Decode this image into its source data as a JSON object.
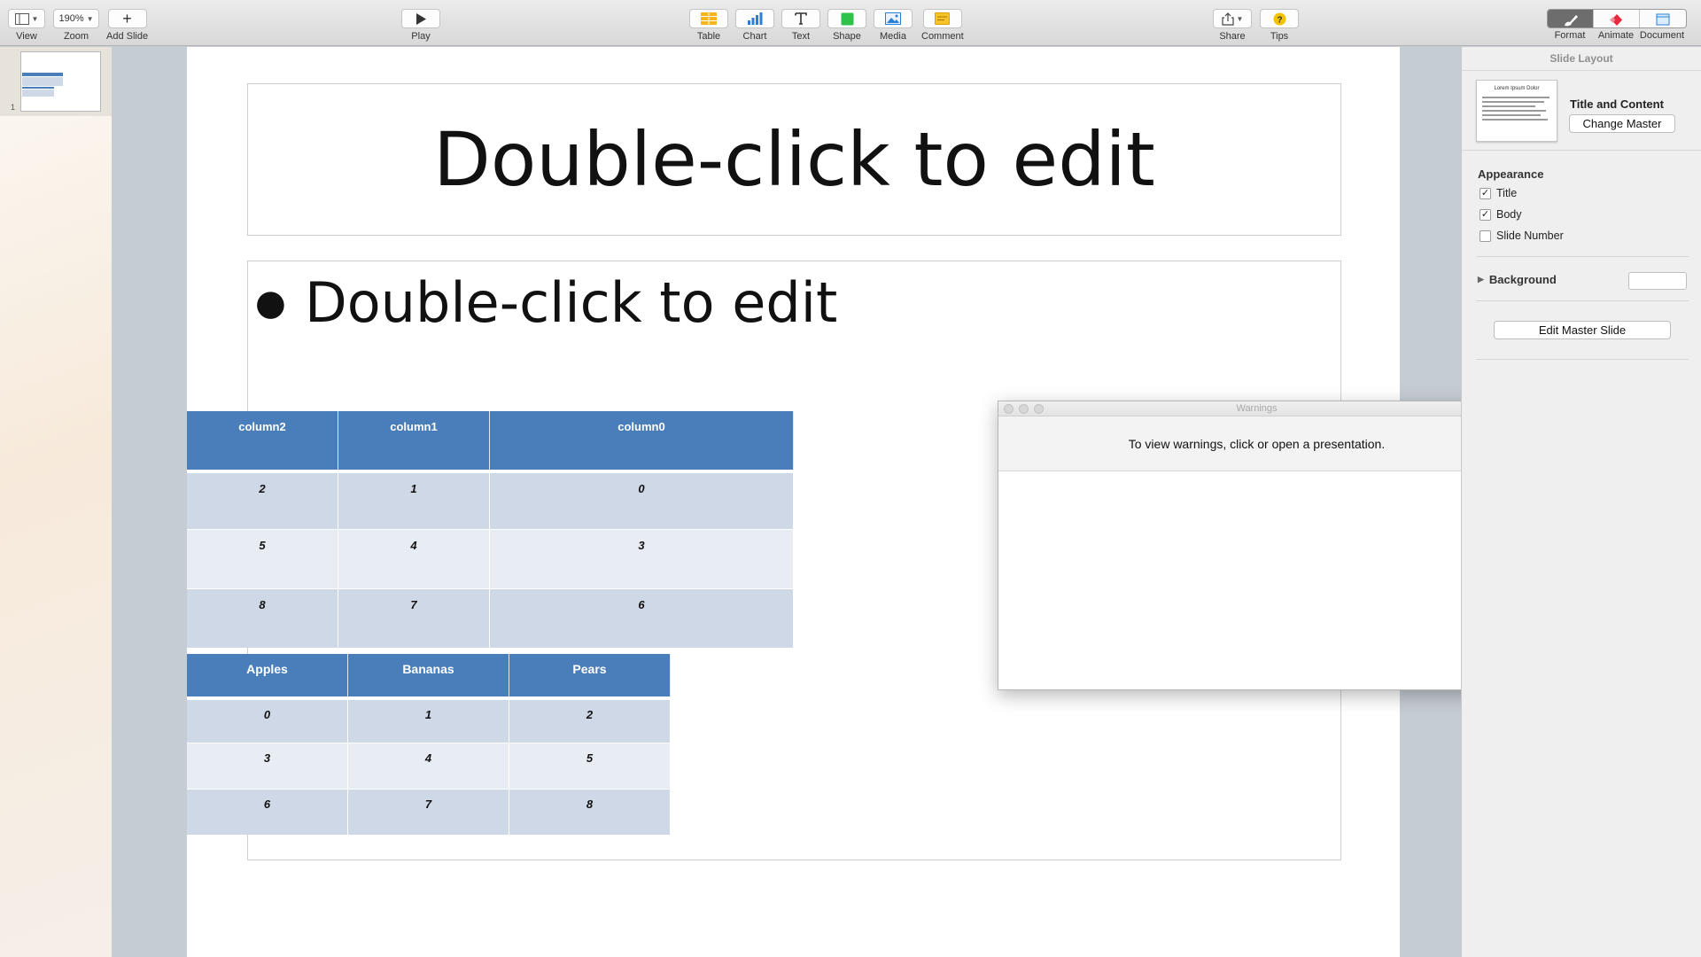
{
  "toolbar": {
    "view_label": "View",
    "zoom_value": "190%",
    "zoom_label": "Zoom",
    "add_slide_label": "Add Slide",
    "play_label": "Play",
    "table_label": "Table",
    "chart_label": "Chart",
    "text_label": "Text",
    "shape_label": "Shape",
    "media_label": "Media",
    "comment_label": "Comment",
    "share_label": "Share",
    "tips_label": "Tips",
    "format_label": "Format",
    "animate_label": "Animate",
    "document_label": "Document"
  },
  "navigator": {
    "slide_number": "1"
  },
  "slide": {
    "title_placeholder": "Double-click to edit",
    "body_placeholder": "Double-click to edit"
  },
  "table1": {
    "headers": [
      "column2",
      "column1",
      "column0"
    ],
    "rows": [
      [
        "2",
        "1",
        "0"
      ],
      [
        "5",
        "4",
        "3"
      ],
      [
        "8",
        "7",
        "6"
      ]
    ]
  },
  "table2": {
    "headers": [
      "Apples",
      "Bananas",
      "Pears"
    ],
    "rows": [
      [
        "0",
        "1",
        "2"
      ],
      [
        "3",
        "4",
        "5"
      ],
      [
        "6",
        "7",
        "8"
      ]
    ]
  },
  "warnings": {
    "title": "Warnings",
    "message": "To view warnings, click or open a presentation."
  },
  "inspector": {
    "header": "Slide Layout",
    "layout_thumb_title": "Lorem Ipsum Dolor",
    "layout_name": "Title and Content",
    "change_master_label": "Change Master",
    "appearance_title": "Appearance",
    "checkboxes": [
      {
        "label": "Title",
        "checked": true
      },
      {
        "label": "Body",
        "checked": true
      },
      {
        "label": "Slide Number",
        "checked": false
      }
    ],
    "background_label": "Background",
    "edit_master_label": "Edit Master Slide"
  },
  "colors": {
    "table_header": "#4a7ebb",
    "table_row_odd": "#cfd8e7",
    "table_row_even": "#e8edf4",
    "animate_accent": "#e8283c",
    "document_accent": "#2a7fd6",
    "tips_accent": "#f2c200",
    "shape_accent": "#2ec24a",
    "table_accent": "#f6b51a"
  }
}
